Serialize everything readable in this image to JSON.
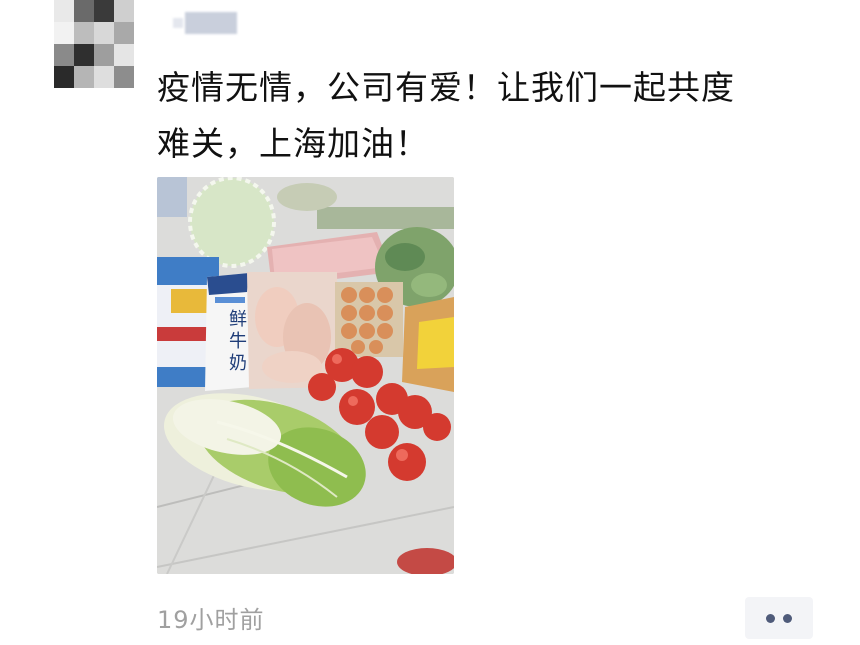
{
  "post": {
    "text": "疫情无情，公司有爱！让我们一起共度\n难关，上海加油！",
    "timestamp": "19小时前"
  },
  "photo": {
    "milk_carton_lines": [
      "鲜",
      "牛",
      "奶"
    ]
  },
  "actions": {
    "more_icon": "more-dots-icon"
  }
}
